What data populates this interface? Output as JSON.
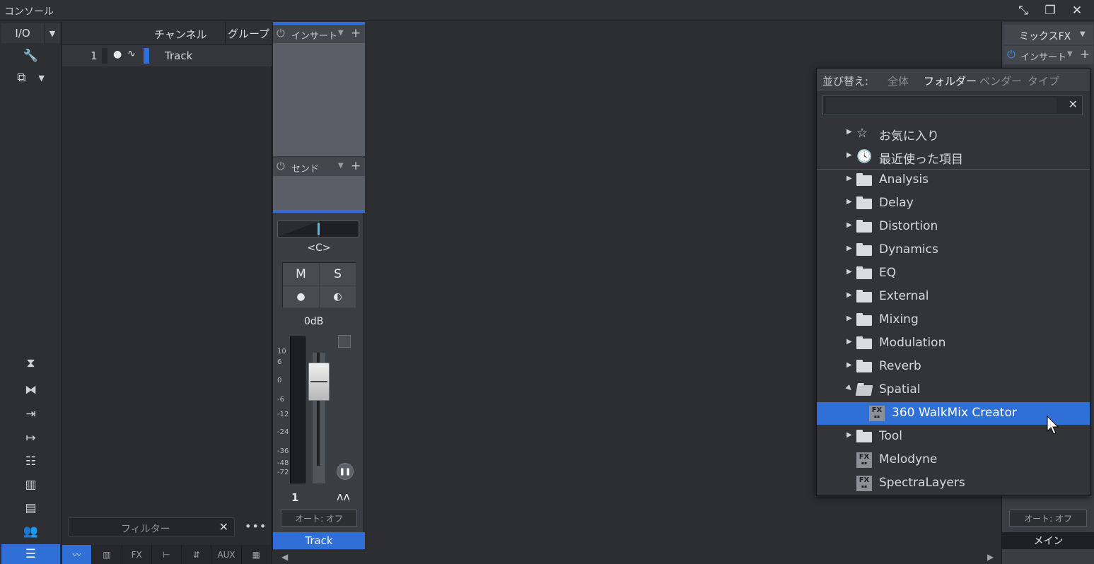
{
  "window": {
    "title": "コンソール",
    "controls": [
      "collapse-icon",
      "restore-icon",
      "close-icon"
    ]
  },
  "leftbar": {
    "io_label": "I/O",
    "buttons": [
      "wrench-icon",
      "plug-icon",
      "collapse-vertical-icon",
      "expand-horizontal-icon",
      "input-icon",
      "output-icon",
      "mixer-icon",
      "keyboard-icon",
      "stack-icon",
      "people-icon",
      "list-icon"
    ]
  },
  "channel_list": {
    "header_channel": "チャンネル",
    "header_group": "グループ",
    "rows": [
      {
        "number": "1",
        "name": "Track",
        "color": "#2f6fd6"
      }
    ],
    "filter_placeholder": "フィルター",
    "more": "•••",
    "tabs": [
      "waveform-icon",
      "keyboard-icon",
      "FX",
      "output-icon",
      "adjust-icon",
      "AUX",
      "grid-icon"
    ]
  },
  "strip": {
    "insert_label": "インサート",
    "send_label": "センド",
    "pan_value": "<C>",
    "mute": "M",
    "solo": "S",
    "volume": "0dB",
    "scale": [
      "10",
      "6",
      "0",
      "-6",
      "-12",
      "-24",
      "-36",
      "-48",
      "-72"
    ],
    "channel_number": "1",
    "auto": "オート: オフ",
    "name": "Track"
  },
  "main_strip": {
    "mixfx": "ミックスFX",
    "insert_label": "インサート",
    "auto": "オート: オフ",
    "name": "メイン"
  },
  "plugin_browser": {
    "sort_label": "並び替え:",
    "sort_options": [
      "全体",
      "フォルダー",
      "ベンダー",
      "タイプ"
    ],
    "selected_sort": "フォルダー",
    "search_value": "",
    "favorites": "お気に入り",
    "recent": "最近使った項目",
    "folders": [
      "Analysis",
      "Delay",
      "Distortion",
      "Dynamics",
      "EQ",
      "External",
      "Mixing",
      "Modulation",
      "Reverb",
      "Spatial"
    ],
    "spatial_child": "360 WalkMix Creator",
    "tool_folder": "Tool",
    "plugins": [
      "Melodyne",
      "SpectraLayers"
    ],
    "fx_badge": "FX",
    "accent": "#2f6fd6"
  }
}
